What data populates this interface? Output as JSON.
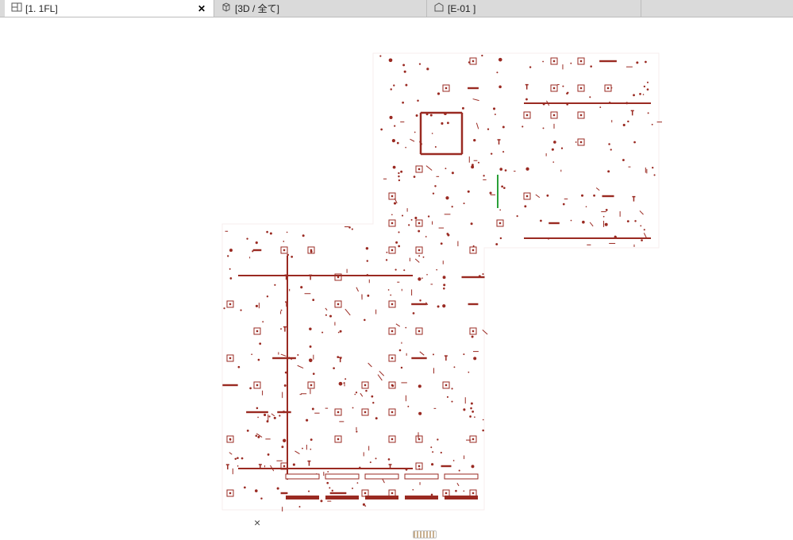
{
  "tabs": [
    {
      "label": "[1. 1FL]",
      "icon": "plan",
      "active": true,
      "closable": true
    },
    {
      "label": "[3D / 全て]",
      "icon": "cube",
      "active": false,
      "closable": false
    },
    {
      "label": "[E-01 ]",
      "icon": "sheet",
      "active": false,
      "closable": false
    }
  ],
  "toolbar": {
    "dash_icon": "dash-toggle-icon",
    "eye_icon": "visibility-icon",
    "selected": "eye"
  },
  "canvas": {
    "background": "#ffffff",
    "plan_color": "#9a2a22",
    "accent_color": "#2aa038",
    "origin_marker": "×",
    "seed": 31337
  }
}
